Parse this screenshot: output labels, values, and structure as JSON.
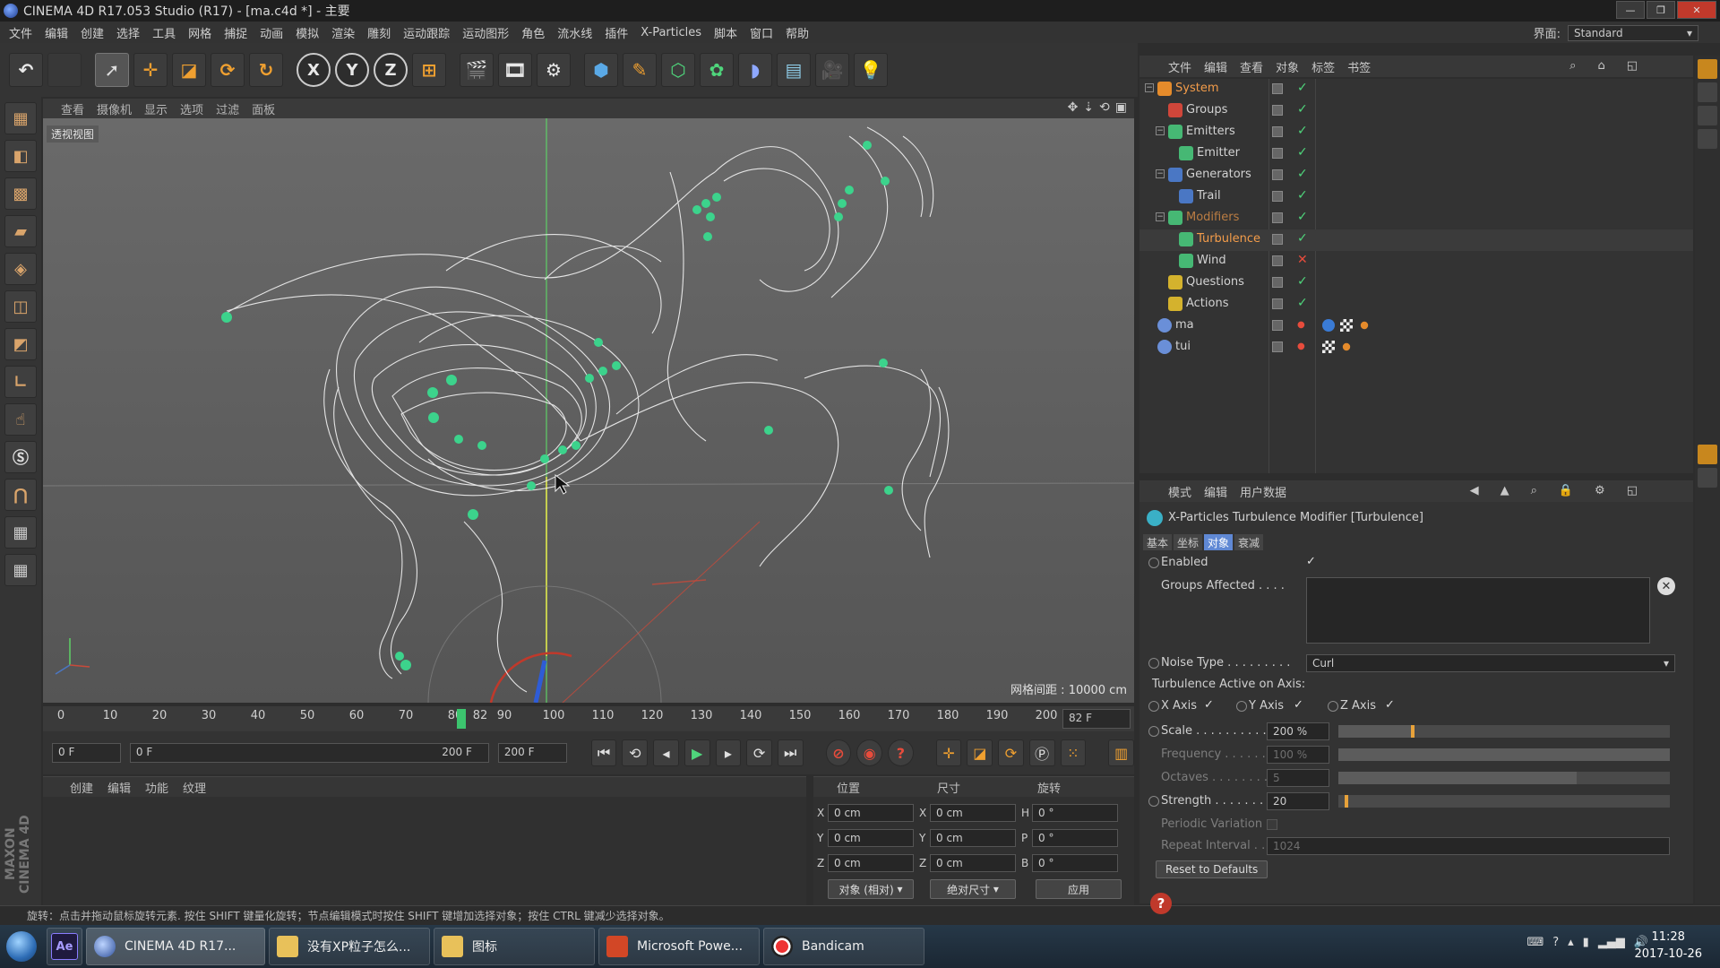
{
  "window": {
    "title": "CINEMA 4D R17.053 Studio (R17) - [ma.c4d *] - 主要"
  },
  "menu": [
    "文件",
    "编辑",
    "创建",
    "选择",
    "工具",
    "网格",
    "捕捉",
    "动画",
    "模拟",
    "渲染",
    "雕刻",
    "运动跟踪",
    "运动图形",
    "角色",
    "流水线",
    "插件",
    "X-Particles",
    "脚本",
    "窗口",
    "帮助"
  ],
  "layout": {
    "label": "界面:",
    "value": "Standard"
  },
  "viewport": {
    "menu": [
      "查看",
      "摄像机",
      "显示",
      "选项",
      "过滤",
      "面板"
    ],
    "view_name": "透视视图",
    "grid_spacing": "网格间距 : 10000 cm"
  },
  "timeline": {
    "ticks": [
      "0",
      "10",
      "20",
      "30",
      "40",
      "50",
      "60",
      "70",
      "80",
      "82",
      "90",
      "100",
      "110",
      "120",
      "130",
      "140",
      "150",
      "160",
      "170",
      "180",
      "190",
      "200"
    ],
    "current_frame": "82 F"
  },
  "playback": {
    "start_field": "0 F",
    "range_start": "0 F",
    "range_end": "200 F",
    "end_field": "200 F"
  },
  "material": {
    "menu": [
      "创建",
      "编辑",
      "功能",
      "纹理"
    ]
  },
  "coords": {
    "headers": {
      "position": "位置",
      "size": "尺寸",
      "rotation": "旋转"
    },
    "rows": [
      {
        "axis": "X",
        "pos": "0 cm",
        "size_axis": "X",
        "size": "0 cm",
        "rot_axis": "H",
        "rot": "0 °"
      },
      {
        "axis": "Y",
        "pos": "0 cm",
        "size_axis": "Y",
        "size": "0 cm",
        "rot_axis": "P",
        "rot": "0 °"
      },
      {
        "axis": "Z",
        "pos": "0 cm",
        "size_axis": "Z",
        "size": "0 cm",
        "rot_axis": "B",
        "rot": "0 °"
      }
    ],
    "mode_object": "对象 (相对)",
    "mode_size": "绝对尺寸",
    "apply": "应用"
  },
  "status": "旋转：点击并拖动鼠标旋转元素. 按住 SHIFT 键量化旋转；节点编辑模式时按住 SHIFT 键增加选择对象；按住 CTRL 键减少选择对象。",
  "object_manager": {
    "menu": [
      "文件",
      "编辑",
      "查看",
      "对象",
      "标签",
      "书签"
    ],
    "items": [
      {
        "label": "System",
        "selected": true,
        "enabled": true
      },
      {
        "label": "Groups",
        "selected": false,
        "enabled": true
      },
      {
        "label": "Emitters",
        "selected": false,
        "enabled": true
      },
      {
        "label": "Emitter",
        "selected": false,
        "enabled": true
      },
      {
        "label": "Generators",
        "selected": false,
        "enabled": true
      },
      {
        "label": "Trail",
        "selected": false,
        "enabled": true
      },
      {
        "label": "Modifiers",
        "selected": true,
        "enabled": true
      },
      {
        "label": "Turbulence",
        "selected": true,
        "enabled": true
      },
      {
        "label": "Wind",
        "selected": false,
        "enabled": false
      },
      {
        "label": "Questions",
        "selected": false,
        "enabled": true
      },
      {
        "label": "Actions",
        "selected": false,
        "enabled": true
      },
      {
        "label": "ma",
        "selected": false,
        "enabled": true
      },
      {
        "label": "tui",
        "selected": false,
        "enabled": true
      }
    ]
  },
  "attributes": {
    "menu": [
      "模式",
      "编辑",
      "用户数据"
    ],
    "title": "X-Particles Turbulence Modifier [Turbulence]",
    "tabs": [
      "基本",
      "坐标",
      "对象",
      "衰减"
    ],
    "active_tab": "对象",
    "enabled_label": "Enabled",
    "groups_label": "Groups Affected . . . .",
    "noise_type_label": "Noise Type . . . . . . . . .",
    "noise_type_value": "Curl",
    "axis_heading": "Turbulence Active on Axis:",
    "x_axis": "X Axis",
    "y_axis": "Y Axis",
    "z_axis": "Z Axis",
    "scale_label": "Scale . . . . . . . . . . . . .",
    "scale_value": "200 %",
    "scale_fraction": 0.22,
    "frequency_label": "Frequency . . . . . . . . .",
    "frequency_value": "100 %",
    "octaves_label": "Octaves . . . . . . . . . .",
    "octaves_value": "5",
    "octaves_fraction": 0.72,
    "strength_label": "Strength . . . . . . . . . .",
    "strength_value": "20",
    "strength_fraction": 0.02,
    "periodic_label": "Periodic Variation",
    "repeat_label": "Repeat Interval . . .",
    "repeat_value": "1024",
    "reset_label": "Reset to Defaults"
  },
  "taskbar": {
    "tasks": [
      "CINEMA 4D R17...",
      "没有XP粒子怎么...",
      "图标",
      "Microsoft Powe...",
      "Bandicam"
    ],
    "time": "11:28",
    "date": "2017-10-26"
  },
  "colors": {
    "accent_orange": "#f39c4a",
    "particle_green": "#3cd38c",
    "timeline_green": "#3cc46e"
  }
}
